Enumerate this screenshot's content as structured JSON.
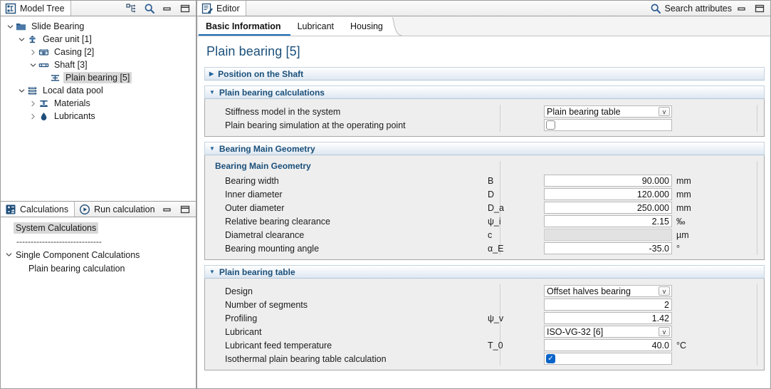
{
  "model_tree_panel": {
    "tab_label": "Model Tree",
    "icons": [
      "tree-layout-icon",
      "search-icon",
      "minimize-icon",
      "maximize-icon"
    ],
    "nodes": [
      {
        "label": "Slide Bearing",
        "indent": 0,
        "twisty": "down",
        "icon": "folder-icon",
        "selected": false
      },
      {
        "label": "Gear unit [1]",
        "indent": 1,
        "twisty": "down",
        "icon": "gear-unit-icon",
        "selected": false
      },
      {
        "label": "Casing [2]",
        "indent": 2,
        "twisty": "right",
        "icon": "casing-icon",
        "selected": false
      },
      {
        "label": "Shaft [3]",
        "indent": 2,
        "twisty": "down",
        "icon": "shaft-icon",
        "selected": false
      },
      {
        "label": "Plain bearing [5]",
        "indent": 3,
        "twisty": "none",
        "icon": "plain-bearing-icon",
        "selected": true
      },
      {
        "label": "Local data pool",
        "indent": 1,
        "twisty": "down",
        "icon": "data-pool-icon",
        "selected": false
      },
      {
        "label": "Materials",
        "indent": 2,
        "twisty": "right",
        "icon": "material-icon",
        "selected": false
      },
      {
        "label": "Lubricants",
        "indent": 2,
        "twisty": "right",
        "icon": "lubricant-drop-icon",
        "selected": false
      }
    ]
  },
  "calculations_panel": {
    "tab_label": "Calculations",
    "run_label": "Run calculation",
    "icons": [
      "minimize-icon",
      "maximize-icon"
    ],
    "rows": [
      {
        "label": "System Calculations",
        "indent": 1,
        "twisty": "none",
        "selected": true,
        "dashed": false
      },
      {
        "label": "------------------------------",
        "indent": 1,
        "twisty": "none",
        "selected": false,
        "dashed": true
      },
      {
        "label": "Single Component Calculations",
        "indent": 0,
        "twisty": "down",
        "selected": false,
        "dashed": false
      },
      {
        "label": "Plain bearing calculation",
        "indent": 2,
        "twisty": "none",
        "selected": false,
        "dashed": false
      }
    ]
  },
  "editor": {
    "tab_label": "Editor",
    "search_label": "Search attributes",
    "icons": [
      "search-icon",
      "minimize-icon",
      "maximize-icon"
    ],
    "tabs": [
      {
        "label": "Basic Information",
        "active": true
      },
      {
        "label": "Lubricant",
        "active": false
      },
      {
        "label": "Housing",
        "active": false
      }
    ],
    "page_title": "Plain bearing [5]",
    "sections": [
      {
        "title": "Position on the Shaft",
        "expanded": false,
        "subtitle": "",
        "rows": []
      },
      {
        "title": "Plain bearing calculations",
        "expanded": true,
        "subtitle": "",
        "rows": [
          {
            "label": "Stiffness model in the system",
            "symbol": "",
            "type": "combo",
            "value": "Plain bearing table",
            "unit": ""
          },
          {
            "label": "Plain bearing simulation at the operating point",
            "symbol": "",
            "type": "checkbox",
            "value": false,
            "unit": ""
          }
        ]
      },
      {
        "title": "Bearing Main Geometry",
        "expanded": true,
        "subtitle": "Bearing Main Geometry",
        "rows": [
          {
            "label": "Bearing width",
            "symbol": "B",
            "type": "number",
            "value": "90.000",
            "unit": "mm"
          },
          {
            "label": "Inner diameter",
            "symbol": "D",
            "type": "number",
            "value": "120.000",
            "unit": "mm"
          },
          {
            "label": "Outer diameter",
            "symbol": "D_a",
            "type": "number",
            "value": "250.000",
            "unit": "mm"
          },
          {
            "label": "Relative bearing clearance",
            "symbol": "ψ_i",
            "type": "number",
            "value": "2.15",
            "unit": "‰"
          },
          {
            "label": "Diametral clearance",
            "symbol": "c",
            "type": "disabled",
            "value": "",
            "unit": "µm"
          },
          {
            "label": "Bearing mounting angle",
            "symbol": "α_E",
            "type": "number",
            "value": "-35.0",
            "unit": "°"
          }
        ]
      },
      {
        "title": "Plain bearing table",
        "expanded": true,
        "subtitle": "",
        "rows": [
          {
            "label": "Design",
            "symbol": "",
            "type": "combo",
            "value": "Offset halves bearing",
            "unit": ""
          },
          {
            "label": "Number of segments",
            "symbol": "",
            "type": "number",
            "value": "2",
            "unit": ""
          },
          {
            "label": "Profiling",
            "symbol": "ψ_v",
            "type": "number",
            "value": "1.42",
            "unit": ""
          },
          {
            "label": "Lubricant",
            "symbol": "",
            "type": "combo",
            "value": "ISO-VG-32 [6]",
            "unit": ""
          },
          {
            "label": "Lubricant feed temperature",
            "symbol": "T_0",
            "type": "number",
            "value": "40.0",
            "unit": "°C"
          },
          {
            "label": "Isothermal plain bearing table calculation",
            "symbol": "",
            "type": "checkbox",
            "value": true,
            "unit": ""
          }
        ]
      }
    ]
  },
  "colors": {
    "accent_blue": "#1a4f7a",
    "checkbox_checked": "#0a64c8",
    "tab_underline": "#1a6bb5",
    "panel_bg": "#eeeeee"
  }
}
